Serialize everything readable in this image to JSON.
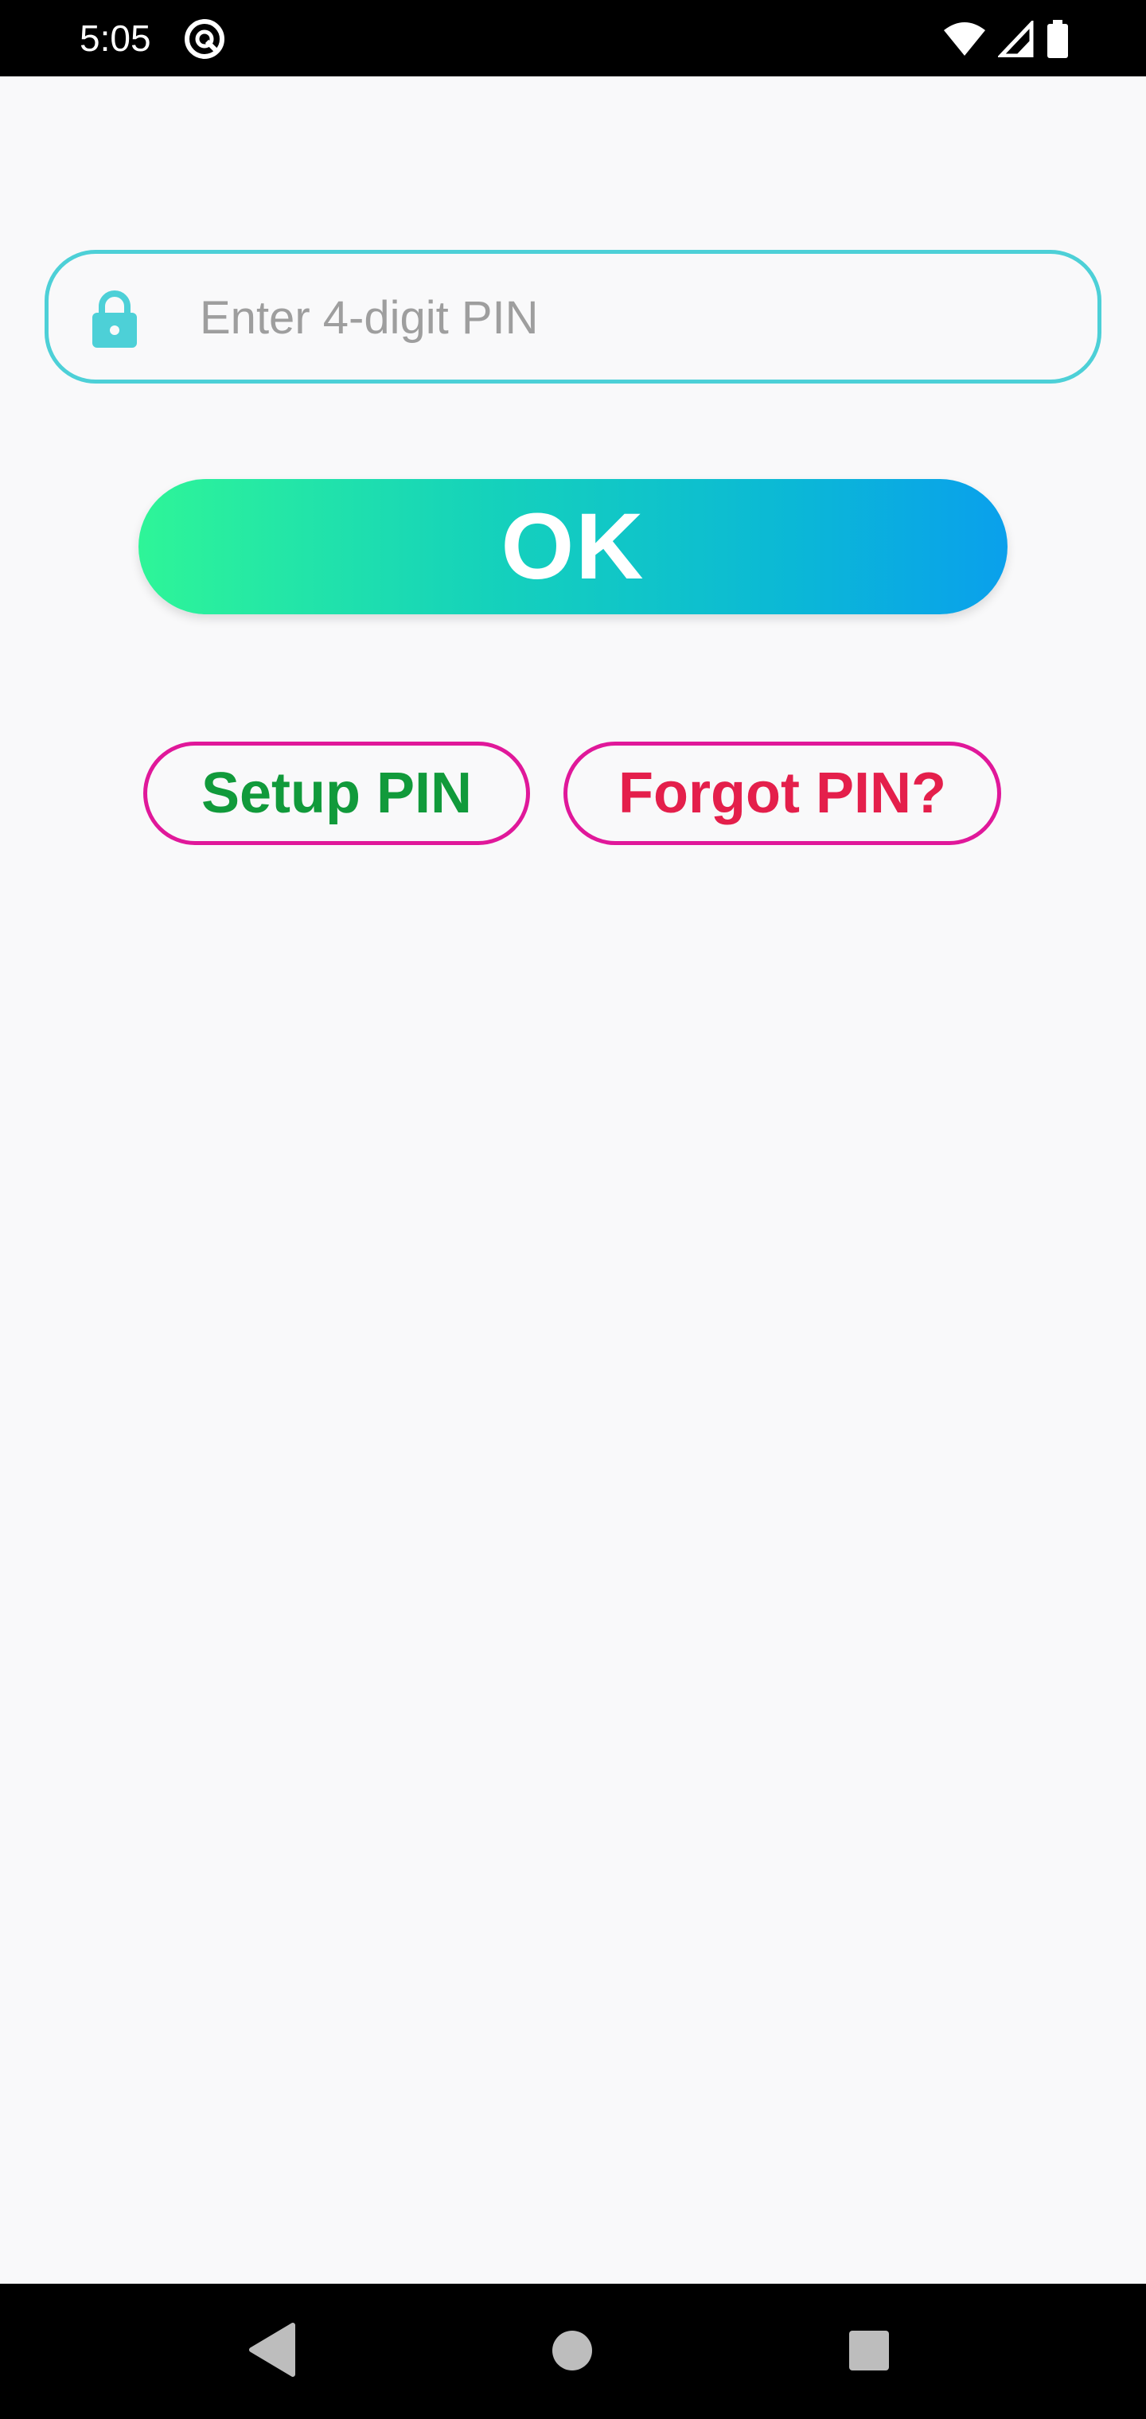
{
  "status_bar": {
    "time": "5:05",
    "icons": [
      "app-notification-icon",
      "wifi-icon",
      "cell-signal-icon",
      "battery-icon"
    ]
  },
  "pin_field": {
    "placeholder": "Enter 4-digit PIN",
    "value": "",
    "icon": "lock-icon"
  },
  "ok_button": {
    "label": "OK"
  },
  "setup_button": {
    "label": "Setup PIN"
  },
  "forgot_button": {
    "label": "Forgot PIN?"
  },
  "nav_bar": {
    "icons": [
      "back-icon",
      "home-icon",
      "recents-icon"
    ]
  },
  "colors": {
    "accent_teal": "#4dd0d7",
    "ok_gradient_start": "#2ef598",
    "ok_gradient_end": "#0aa0ec",
    "pill_border": "#e0189a",
    "setup_text": "#119a3b",
    "forgot_text": "#e41f4b",
    "background": "#f9f9fa"
  }
}
